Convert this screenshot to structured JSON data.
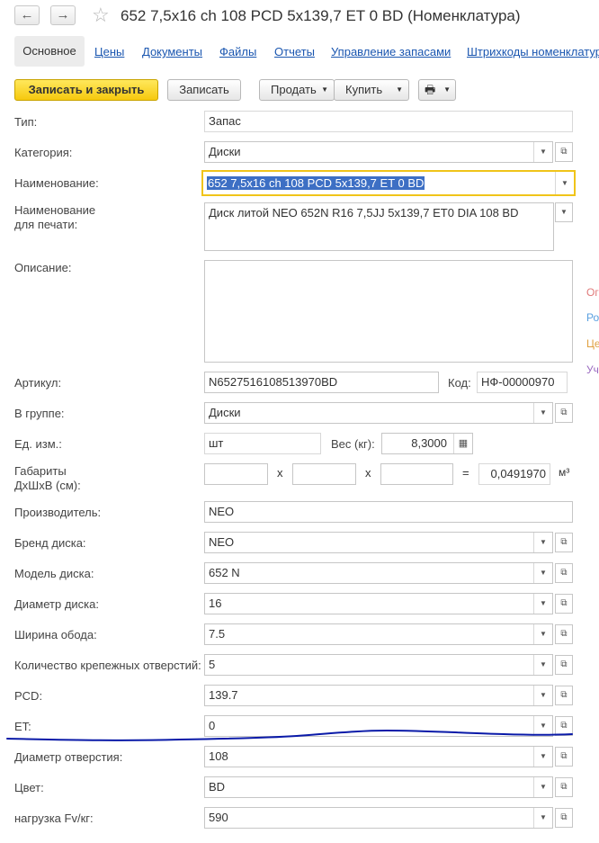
{
  "window": {
    "title": "652 7,5x16 ch 108 PCD 5x139,7 ET 0 BD (Номенклатура)",
    "back_icon": "←",
    "forward_icon": "→",
    "star_icon": "☆"
  },
  "tabs": {
    "active": "Основное",
    "items": [
      "Цены",
      "Документы",
      "Файлы",
      "Отчеты",
      "Управление запасами",
      "Штрихкоды номенклатур"
    ]
  },
  "toolbar": {
    "save_close": "Записать и закрыть",
    "save": "Записать",
    "sell": "Продать",
    "buy": "Купить",
    "print_icon": "🖶"
  },
  "form": {
    "type_label": "Тип:",
    "type_value": "Запас",
    "category_label": "Категория:",
    "category_value": "Диски",
    "name_label": "Наименование:",
    "name_value": "652 7,5x16 ch 108 PCD 5x139,7 ET 0 BD",
    "print_name_label_1": "Наименование",
    "print_name_label_2": "для печати:",
    "print_name_value": "Диск литой NEO 652N R16 7,5JJ 5x139,7 ET0 DIA 108 BD",
    "description_label": "Описание:",
    "description_value": "",
    "article_label": "Артикул:",
    "article_value": "N6527516108513970BD",
    "code_label": "Код:",
    "code_value": "НФ-00000970",
    "group_label": "В группе:",
    "group_value": "Диски",
    "unit_label": "Ед. изм.:",
    "unit_value": "шт",
    "weight_label": "Вес (кг):",
    "weight_value": "8,3000",
    "dims_label_1": "Габариты",
    "dims_label_2": "ДхШхВ (см):",
    "dims_x": "x",
    "dims_eq": "=",
    "volume_value": "0,0491970",
    "volume_unit": "м³",
    "manufacturer_label": "Производитель:",
    "manufacturer_value": "NEO",
    "brand_label": "Бренд диска:",
    "brand_value": "NEO",
    "model_label": "Модель диска:",
    "model_value": "652 N",
    "diameter_label": "Диаметр диска:",
    "diameter_value": "16",
    "rim_label": "Ширина обода:",
    "rim_value": "7.5",
    "holes_label": "Количество крепежных отверстий:",
    "holes_value": "5",
    "pcd_label": "PCD:",
    "pcd_value": "139.7",
    "et_label": "ET:",
    "et_value": "0",
    "hole_diameter_label": "Диаметр отверстия:",
    "hole_diameter_value": "108",
    "color_label": "Цвет:",
    "color_value": "BD",
    "load_label": "нагрузка Fv/кг:",
    "load_value": "590"
  },
  "side_labels": [
    "Ог",
    "Ро",
    "Це",
    "Уч"
  ],
  "colors": {
    "primary_button": "#f6c90e",
    "link": "#1a56b0",
    "focus_border": "#f0c419",
    "selection": "#3d6fc4",
    "annotation_line": "#0a1aa8"
  }
}
